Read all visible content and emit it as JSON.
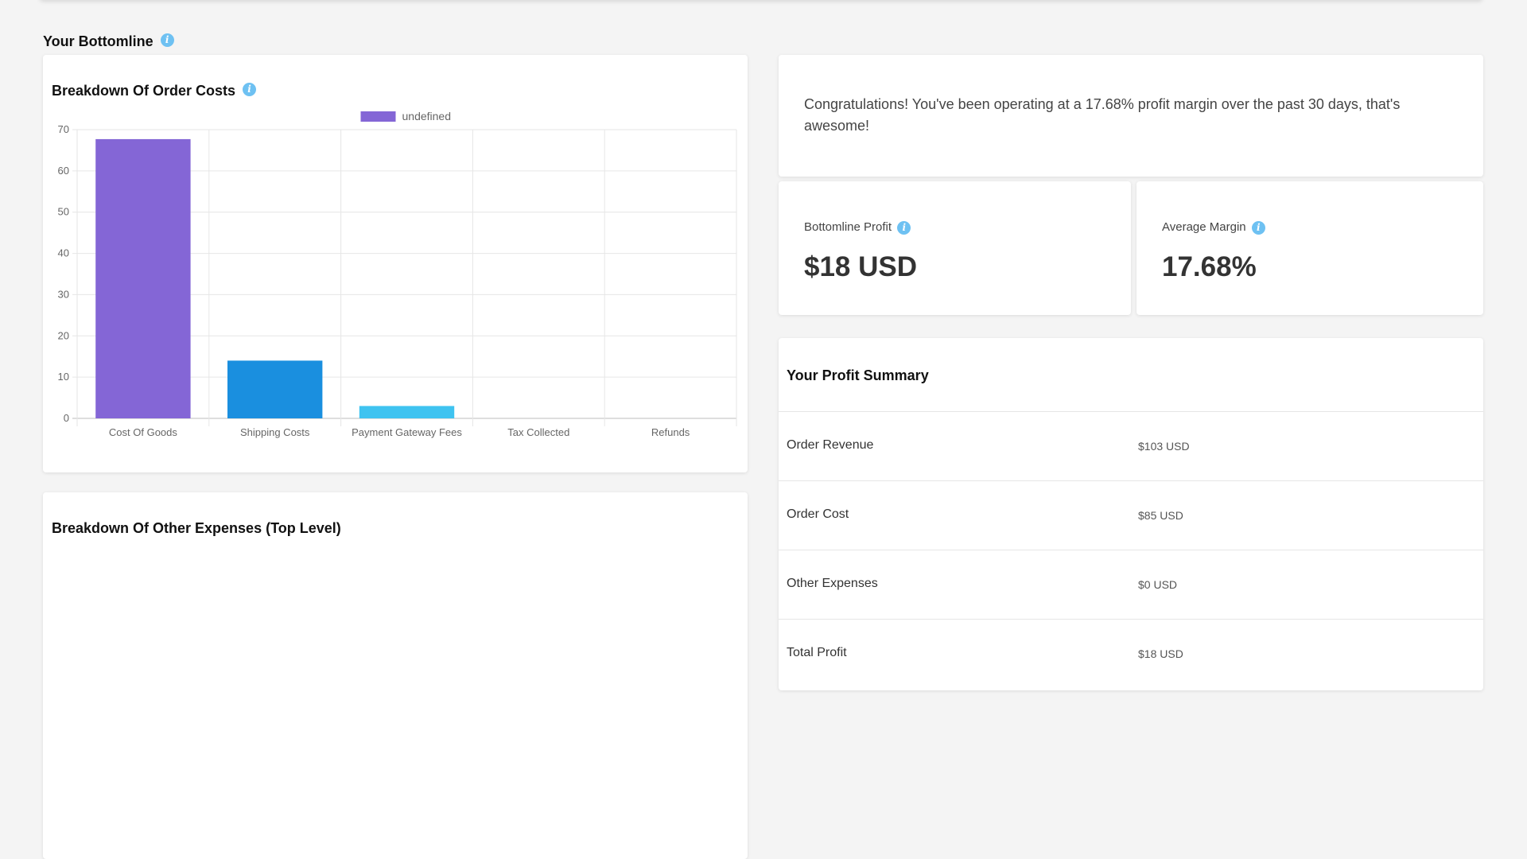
{
  "section": {
    "title": "Your Bottomline"
  },
  "order_costs": {
    "title": "Breakdown Of Order Costs"
  },
  "other_expenses": {
    "title": "Breakdown Of Other Expenses (Top Level)"
  },
  "congrats": {
    "message": "Congratulations! You've been operating at a 17.68% profit margin over the past 30 days, that's awesome!"
  },
  "metrics": {
    "profit_label": "Bottomline Profit",
    "profit_value": "$18 USD",
    "margin_label": "Average Margin",
    "margin_value": "17.68%"
  },
  "summary": {
    "title": "Your Profit Summary",
    "rows": [
      {
        "label": "Order Revenue",
        "value": "$103 USD"
      },
      {
        "label": "Order Cost",
        "value": "$85 USD"
      },
      {
        "label": "Other Expenses",
        "value": "$0 USD"
      },
      {
        "label": "Total Profit",
        "value": "$18 USD"
      }
    ]
  },
  "colors": {
    "bar_1": "#8466d6",
    "bar_2": "#1a8fdf",
    "bar_3": "#3fc3f0",
    "info_icon": "#6ec1f2"
  },
  "chart_data": {
    "type": "bar",
    "categories": [
      "Cost Of Goods",
      "Shipping Costs",
      "Payment Gateway Fees",
      "Tax Collected",
      "Refunds"
    ],
    "values": [
      67.7,
      14,
      3,
      0,
      0
    ],
    "series": [
      {
        "name": "undefined",
        "values": [
          67.7,
          14,
          3,
          0,
          0
        ]
      }
    ],
    "bar_colors": [
      "#8466d6",
      "#1a8fdf",
      "#3fc3f0",
      "#8466d6",
      "#8466d6"
    ],
    "ylim": [
      0,
      70
    ],
    "yticks": [
      0,
      10,
      20,
      30,
      40,
      50,
      60,
      70
    ],
    "legend": "top-center",
    "grid": true
  }
}
